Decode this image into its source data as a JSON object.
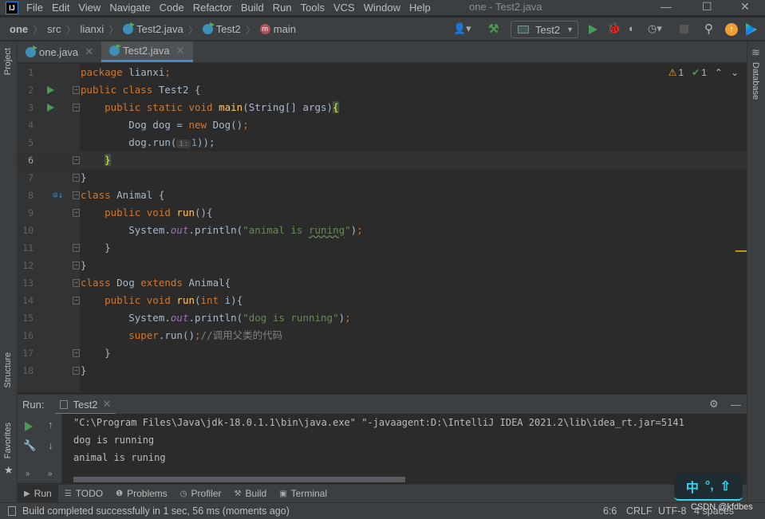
{
  "window": {
    "title": "one - Test2.java",
    "minimize": "—",
    "maximize": "☐",
    "close": "✕"
  },
  "menu": [
    "File",
    "Edit",
    "View",
    "Navigate",
    "Code",
    "Refactor",
    "Build",
    "Run",
    "Tools",
    "VCS",
    "Window",
    "Help"
  ],
  "breadcrumb": [
    "one",
    "src",
    "lianxi",
    "Test2.java",
    "Test2",
    "main"
  ],
  "toolbar": {
    "run_config": "Test2",
    "colors": {
      "run": "#499c54",
      "update": "#f0a030"
    }
  },
  "tabs": [
    {
      "label": "one.java",
      "active": false
    },
    {
      "label": "Test2.java",
      "active": true
    }
  ],
  "left_strip": {
    "project": "Project",
    "structure": "Structure",
    "favorites": "Favorites"
  },
  "right_strip": {
    "database": "Database"
  },
  "inspections": {
    "warnings": "1",
    "weak_warnings": "1"
  },
  "editor": {
    "current_line": 6,
    "lines": [
      [
        [
          "kw",
          "package "
        ],
        [
          "",
          "lianxi"
        ],
        [
          "kw",
          ";"
        ]
      ],
      [
        [
          "kw",
          "public class "
        ],
        [
          "",
          "Test2 {"
        ]
      ],
      [
        [
          "kw",
          "    public static void "
        ],
        [
          "fn",
          "main"
        ],
        [
          "",
          "(String[] args)"
        ],
        [
          "br",
          "{"
        ]
      ],
      [
        [
          "",
          "        Dog dog = "
        ],
        [
          "kw",
          "new "
        ],
        [
          "",
          "Dog()"
        ],
        [
          "kw",
          ";"
        ]
      ],
      [
        [
          "",
          "        dog.run("
        ],
        [
          "hint",
          "i:"
        ],
        [
          "num",
          "1"
        ],
        [
          "",
          "));"
        ]
      ],
      [
        [
          "",
          "    "
        ],
        [
          "br",
          "}"
        ]
      ],
      [
        [
          "",
          "}"
        ]
      ],
      [
        [
          "kw",
          "class "
        ],
        [
          "",
          "Animal {"
        ]
      ],
      [
        [
          "kw",
          "    public void "
        ],
        [
          "fn",
          "run"
        ],
        [
          "",
          "(){"
        ]
      ],
      [
        [
          "",
          "        System."
        ],
        [
          "sf",
          "out"
        ],
        [
          "",
          ".println("
        ],
        [
          "str",
          "\"animal is "
        ],
        [
          "str wavy",
          "runing"
        ],
        [
          "str",
          "\""
        ],
        [
          "",
          ")"
        ],
        [
          "kw",
          ";"
        ]
      ],
      [
        [
          "",
          "    }"
        ]
      ],
      [
        [
          "",
          "}"
        ]
      ],
      [
        [
          "kw",
          "class "
        ],
        [
          "",
          "Dog "
        ],
        [
          "kw",
          "extends "
        ],
        [
          "",
          "Animal{"
        ]
      ],
      [
        [
          "kw",
          "    public void "
        ],
        [
          "fn",
          "run"
        ],
        [
          "",
          "("
        ],
        [
          "kw",
          "int "
        ],
        [
          "",
          "i){"
        ]
      ],
      [
        [
          "",
          "        System."
        ],
        [
          "sf",
          "out"
        ],
        [
          "",
          ".println("
        ],
        [
          "str",
          "\"dog is running\""
        ],
        [
          "",
          ")"
        ],
        [
          "kw",
          ";"
        ]
      ],
      [
        [
          "kw",
          "        super"
        ],
        [
          "",
          ".run()"
        ],
        [
          "kw",
          ";"
        ],
        [
          "cm",
          "//调用父类的代码"
        ]
      ],
      [
        [
          "",
          "    }"
        ]
      ],
      [
        [
          "",
          "}"
        ]
      ]
    ]
  },
  "run_panel": {
    "label": "Run:",
    "tab": "Test2",
    "output": [
      "\"C:\\Program Files\\Java\\jdk-18.0.1.1\\bin\\java.exe\" \"-javaagent:D:\\IntelliJ IDEA 2021.2\\lib\\idea_rt.jar=5141",
      "dog is running",
      "animal is runing"
    ]
  },
  "tool_tabs": [
    "Run",
    "TODO",
    "Problems",
    "Profiler",
    "Build",
    "Terminal"
  ],
  "status": {
    "message": "Build completed successfully in 1 sec, 56 ms (moments ago)",
    "position": "6:6",
    "line_sep": "CRLF",
    "encoding": "UTF-8",
    "indent": "4 spaces"
  },
  "ime": {
    "lang": "中",
    "punct": "°,",
    "shirt": "⇧"
  },
  "watermark": "CSDN @kfdbes"
}
